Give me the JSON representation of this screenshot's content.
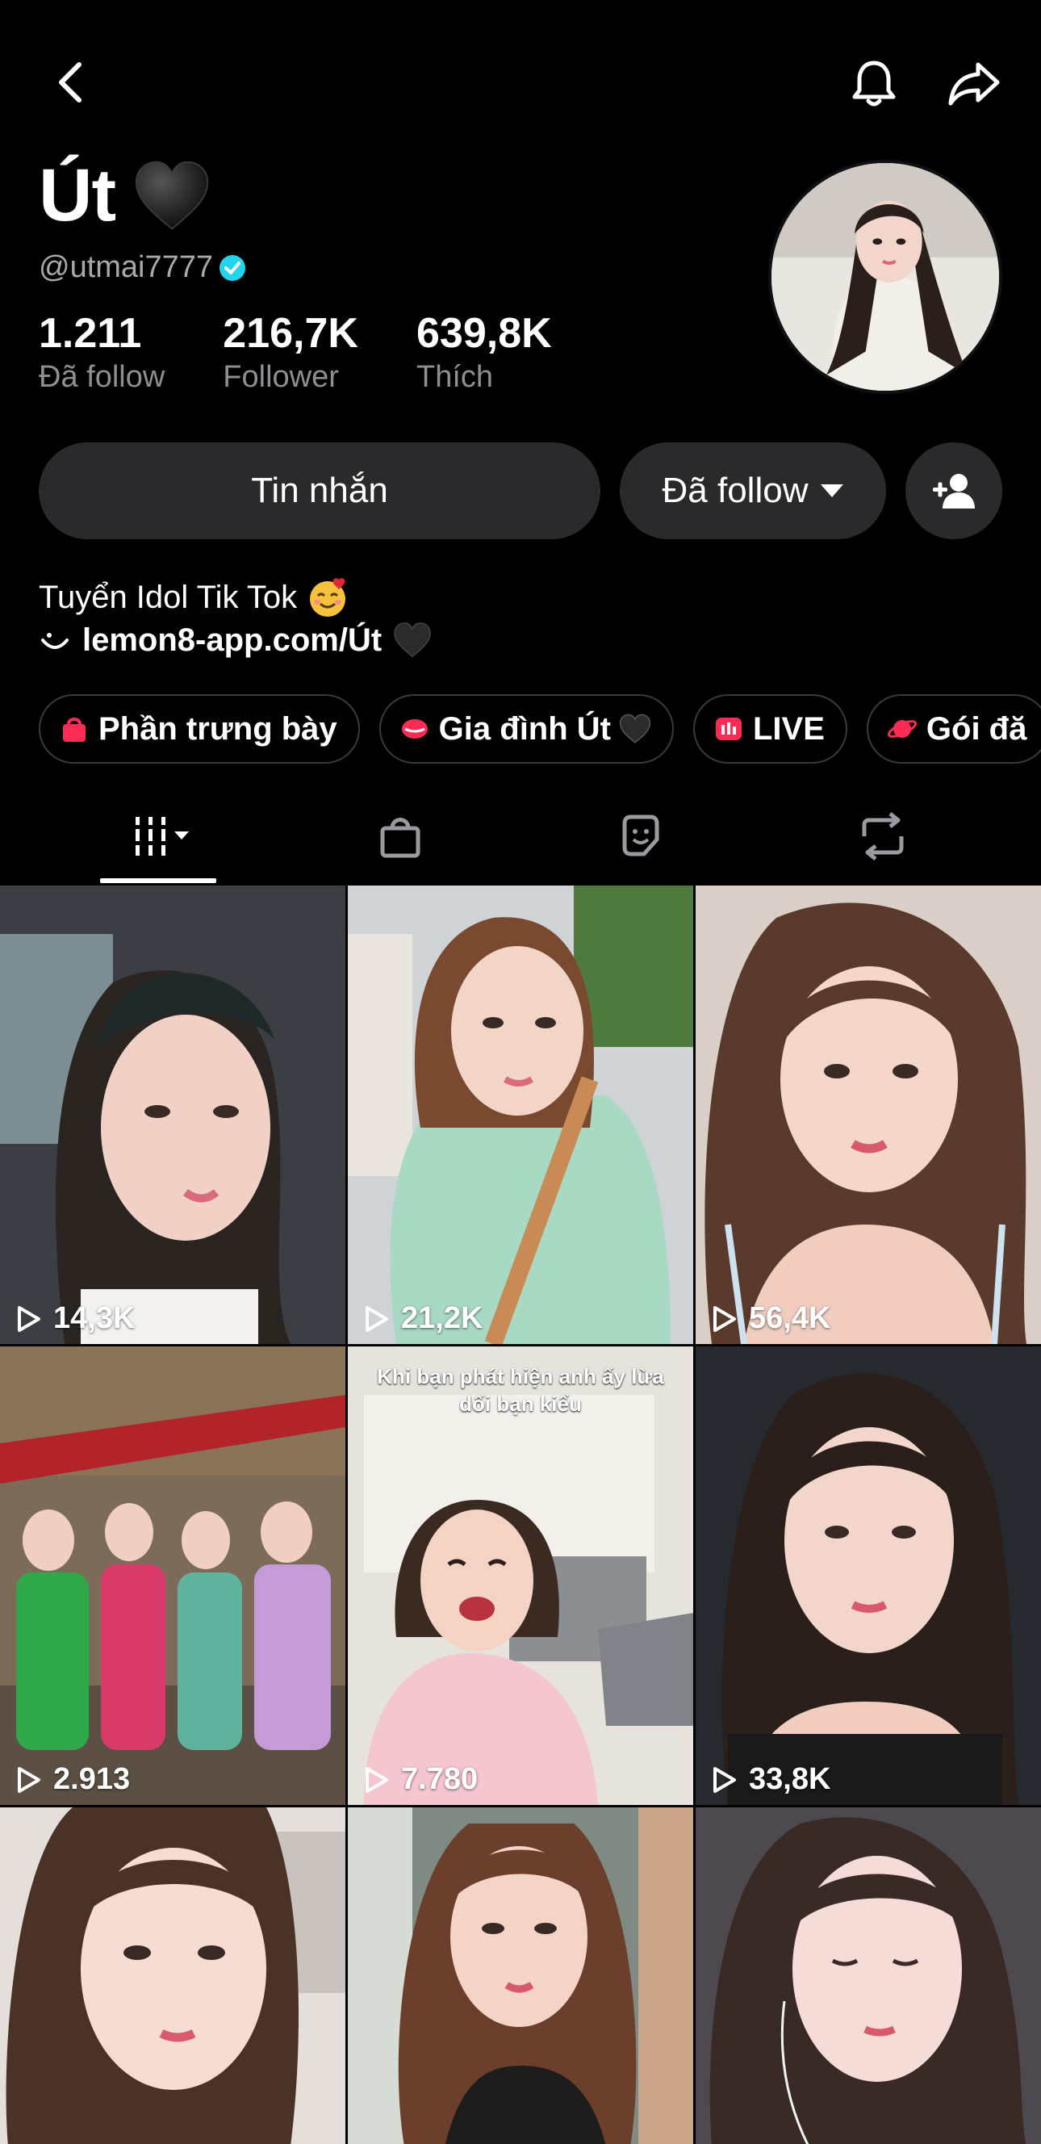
{
  "profile": {
    "name": "Út",
    "handle": "@utmai7777",
    "stats": [
      {
        "value": "1.211",
        "label": "Đã follow"
      },
      {
        "value": "216,7K",
        "label": "Follower"
      },
      {
        "value": "639,8K",
        "label": "Thích"
      }
    ]
  },
  "actions": {
    "message": "Tin nhắn",
    "follow": "Đã follow"
  },
  "bio": {
    "line1": "Tuyển Idol Tik Tok",
    "link": "lemon8-app.com/Út"
  },
  "chips": [
    {
      "label": "Phần trưng bày",
      "icon": "shop-bag-icon",
      "color": "#fe2c55"
    },
    {
      "label": "Gia đình Út",
      "icon": "lips-icon",
      "color": "#fe2c55"
    },
    {
      "label": "LIVE",
      "icon": "live-icon",
      "color": "#fe2c55"
    },
    {
      "label": "Gói đă",
      "icon": "planet-icon",
      "color": "#fe2c55"
    }
  ],
  "tabs": [
    "videos-tab-icon",
    "shop-tab-icon",
    "favorites-tab-icon",
    "reposts-tab-icon"
  ],
  "videos": [
    {
      "views": "14,3K",
      "caption": ""
    },
    {
      "views": "21,2K",
      "caption": ""
    },
    {
      "views": "56,4K",
      "caption": ""
    },
    {
      "views": "2.913",
      "caption": ""
    },
    {
      "views": "7.780",
      "caption": "Khi bạn phát hiện anh ấy lừa dối bạn kiểu"
    },
    {
      "views": "33,8K",
      "caption": ""
    },
    {
      "views": "",
      "caption": ""
    },
    {
      "views": "",
      "caption": ""
    },
    {
      "views": "",
      "caption": ""
    }
  ],
  "colors": {
    "background": "#000000",
    "button": "#2a2a2c",
    "accent": "#fe2c55",
    "verified": "#20d5ec",
    "muted": "#8e8e93"
  }
}
